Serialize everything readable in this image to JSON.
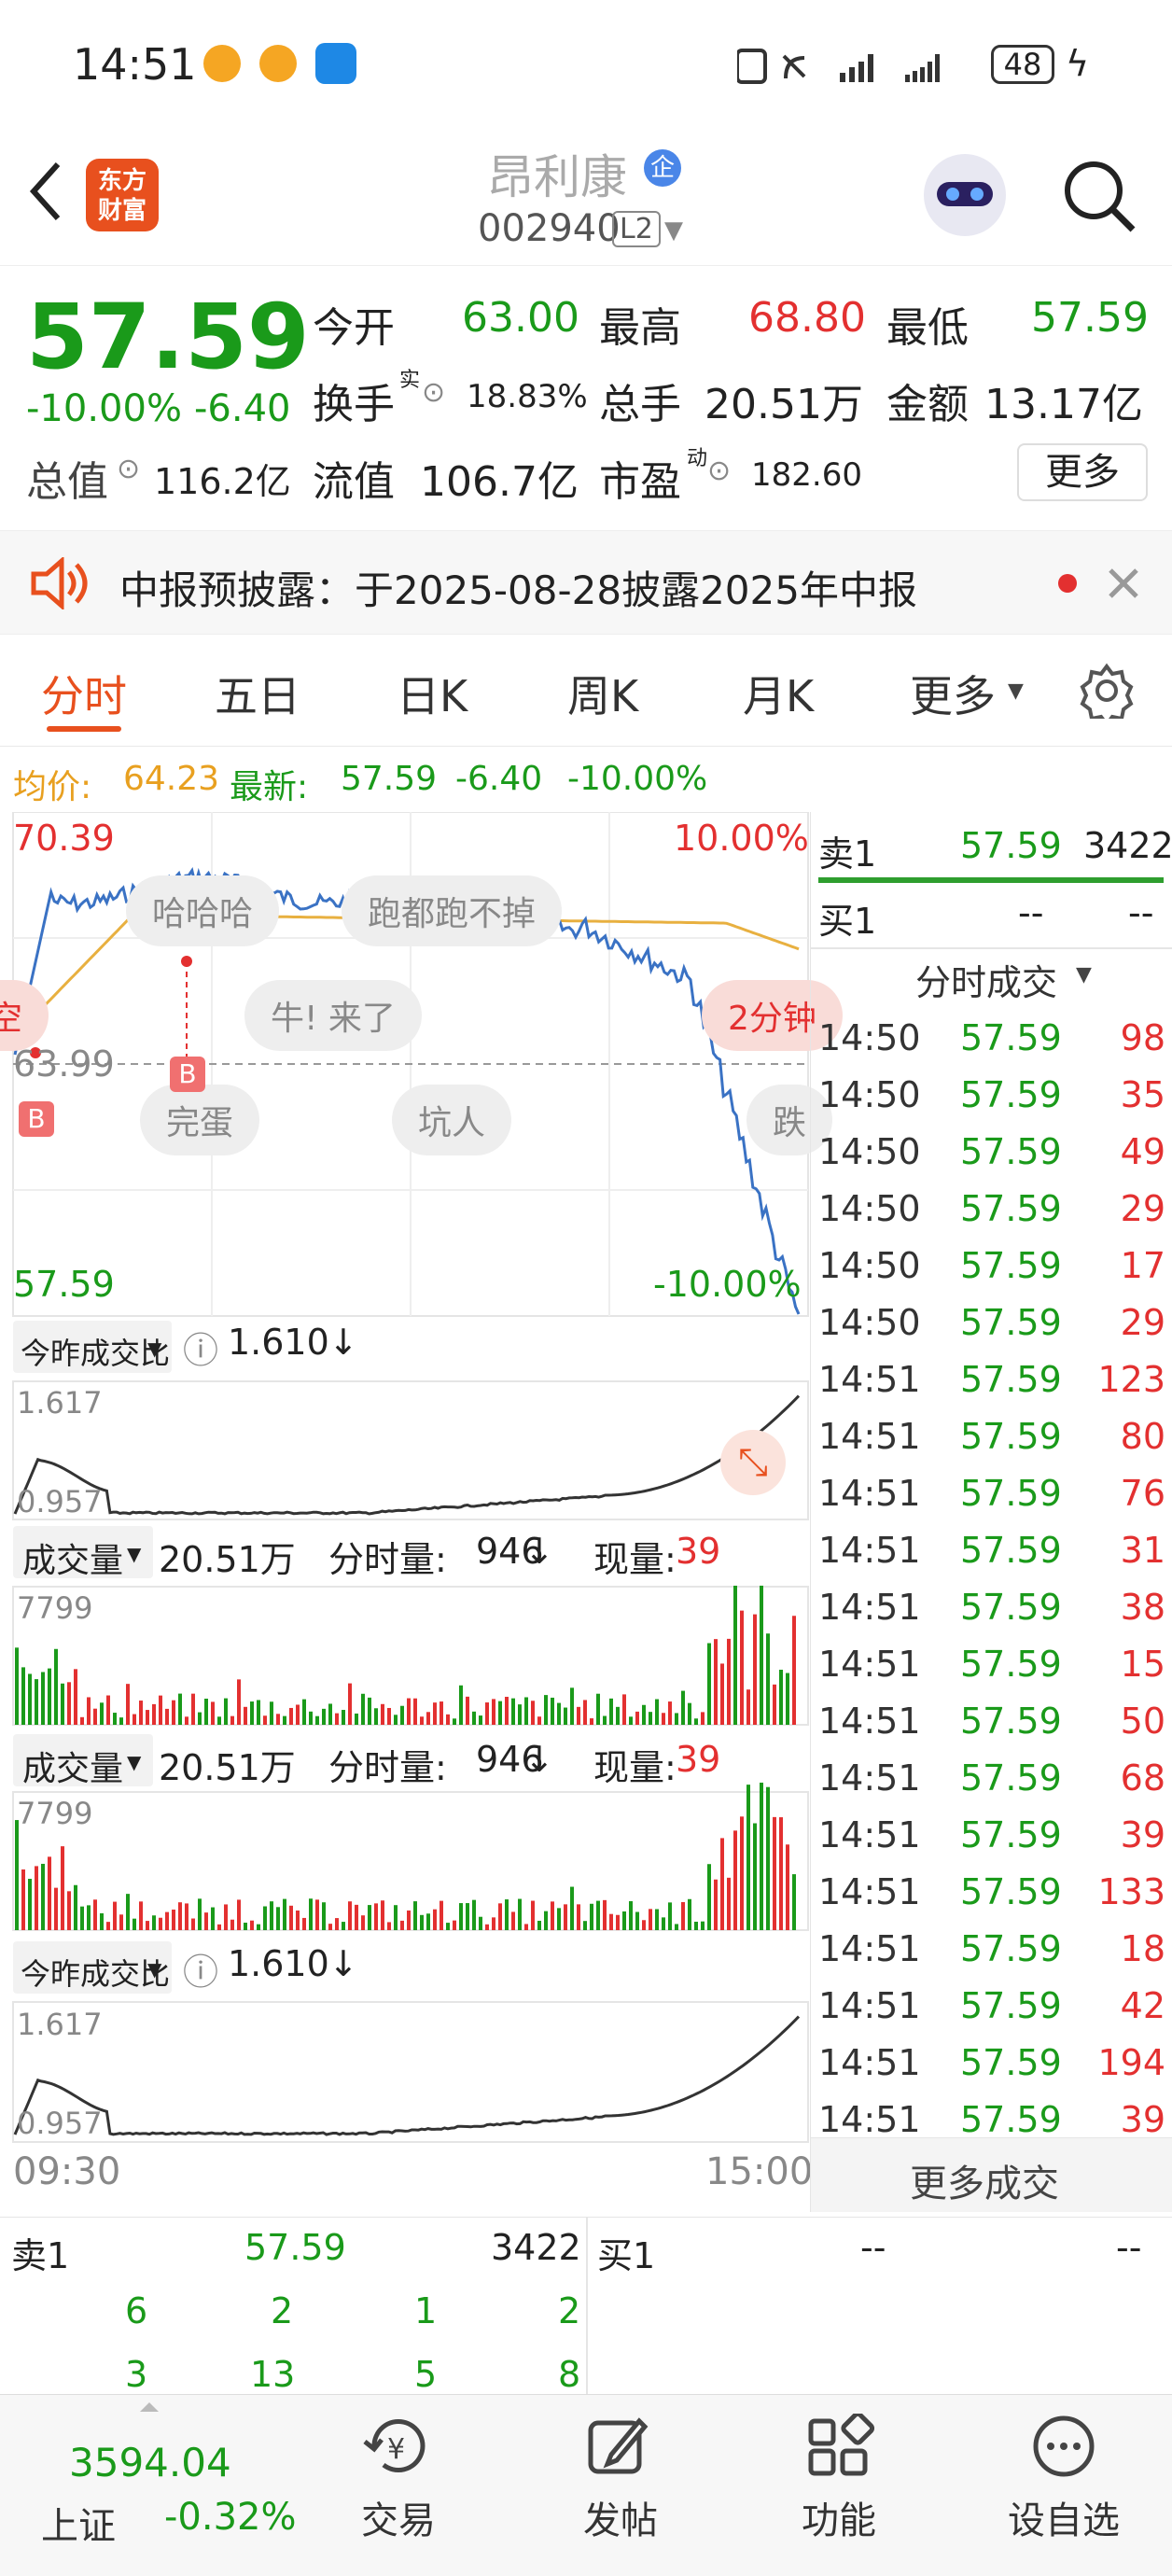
{
  "status_bar": {
    "time": "14:51",
    "battery": "48"
  },
  "header": {
    "stock_name": "昂利康",
    "badge": "企",
    "code": "002940",
    "level": "L2"
  },
  "quote": {
    "price": "57.59",
    "change_pct": "-10.00%",
    "change": "-6.40",
    "open_label": "今开",
    "open": "63.00",
    "high_label": "最高",
    "high": "68.80",
    "low_label": "最低",
    "low": "57.59",
    "turnover_label": "换手",
    "turnover_sup": "实",
    "turnover": "18.83%",
    "volume_label": "总手",
    "volume": "20.51万",
    "amount_label": "金额",
    "amount": "13.17亿",
    "mktcap_label": "总值",
    "mktcap": "116.2亿",
    "float_label": "流值",
    "float": "106.7亿",
    "pe_label": "市盈",
    "pe_sup": "动",
    "pe": "182.60",
    "more": "更多"
  },
  "notice": {
    "text": "中报预披露：于2025-08-28披露2025年中报"
  },
  "tabs": [
    "分时",
    "五日",
    "日K",
    "周K",
    "月K",
    "更多"
  ],
  "avg_line": {
    "avg_label": "均价:",
    "avg": "64.23",
    "latest_label": "最新:",
    "latest": "57.59",
    "change": "-6.40",
    "pct": "-10.00%"
  },
  "chart": {
    "price_high": "70.39",
    "pct_high": "10.00%",
    "price_mid": "63.99",
    "price_low": "57.59",
    "pct_low": "-10.00%",
    "bubbles": [
      "哈哈哈",
      "跑都跑不掉",
      "牛! 来了",
      "完蛋",
      "坑人",
      "2分钟",
      "空",
      "跌"
    ],
    "buy_marker": "B",
    "ratio_label": "今昨成交比",
    "ratio_value": "1.610",
    "ratio_arrow": "↓",
    "ratio_max": "1.617",
    "ratio_min": "0.957",
    "vol_label": "成交量",
    "vol_total": "20.51万",
    "vol_min_label": "分时量:",
    "vol_min": "946",
    "vol_arrow": "↓",
    "vol_now_label": "现量:",
    "vol_now": "39",
    "vol_max": "7799",
    "time_start": "09:30",
    "time_end": "15:00"
  },
  "book": {
    "sell1_label": "卖1",
    "sell1_price": "57.59",
    "sell1_vol": "3422",
    "buy1_label": "买1",
    "buy1_price": "--",
    "buy1_vol": "--",
    "ticks_title": "分时成交",
    "more_ticks": "更多成交",
    "ticks": [
      {
        "t": "14:50",
        "p": "57.59",
        "v": "98"
      },
      {
        "t": "14:50",
        "p": "57.59",
        "v": "35"
      },
      {
        "t": "14:50",
        "p": "57.59",
        "v": "49"
      },
      {
        "t": "14:50",
        "p": "57.59",
        "v": "29"
      },
      {
        "t": "14:50",
        "p": "57.59",
        "v": "17"
      },
      {
        "t": "14:50",
        "p": "57.59",
        "v": "29"
      },
      {
        "t": "14:51",
        "p": "57.59",
        "v": "123"
      },
      {
        "t": "14:51",
        "p": "57.59",
        "v": "80"
      },
      {
        "t": "14:51",
        "p": "57.59",
        "v": "76"
      },
      {
        "t": "14:51",
        "p": "57.59",
        "v": "31"
      },
      {
        "t": "14:51",
        "p": "57.59",
        "v": "38"
      },
      {
        "t": "14:51",
        "p": "57.59",
        "v": "15"
      },
      {
        "t": "14:51",
        "p": "57.59",
        "v": "50"
      },
      {
        "t": "14:51",
        "p": "57.59",
        "v": "68"
      },
      {
        "t": "14:51",
        "p": "57.59",
        "v": "39"
      },
      {
        "t": "14:51",
        "p": "57.59",
        "v": "133"
      },
      {
        "t": "14:51",
        "p": "57.59",
        "v": "18"
      },
      {
        "t": "14:51",
        "p": "57.59",
        "v": "42"
      },
      {
        "t": "14:51",
        "p": "57.59",
        "v": "194"
      },
      {
        "t": "14:51",
        "p": "57.59",
        "v": "39"
      }
    ]
  },
  "bottom_book": {
    "sell1_label": "卖1",
    "sell1_price": "57.59",
    "sell1_vol": "3422",
    "buy1_label": "买1",
    "buy1_price": "--",
    "buy1_vol": "--",
    "row1": [
      "6",
      "2",
      "1",
      "2"
    ],
    "row2": [
      "3",
      "13",
      "5",
      "8"
    ]
  },
  "nav": {
    "index_value": "3594.04",
    "index_name": "上证",
    "index_pct": "-0.32%",
    "items": [
      "交易",
      "发帖",
      "功能",
      "设自选"
    ]
  },
  "colors": {
    "up": "#e33030",
    "down": "#1a9a1a",
    "price_line": "#3a72c4",
    "avg_line": "#e8b040",
    "accent": "#e8501e"
  }
}
